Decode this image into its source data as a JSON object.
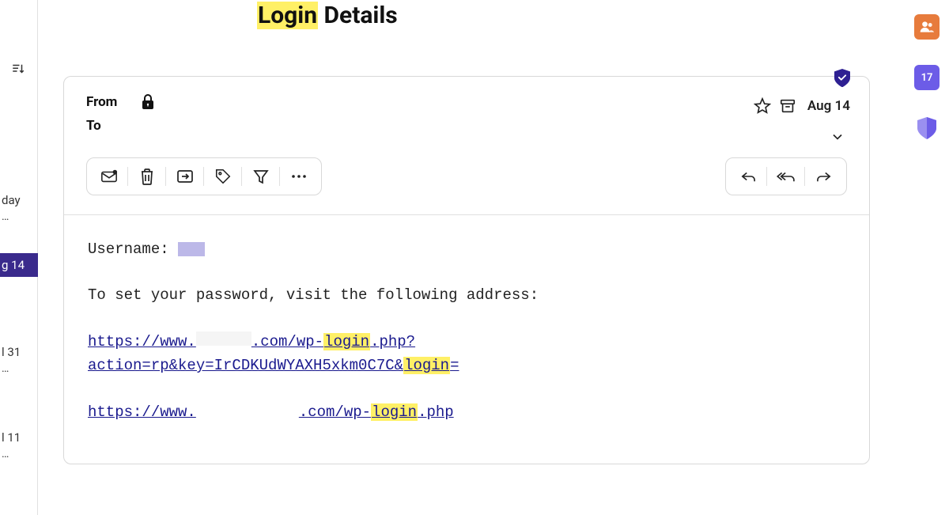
{
  "title": {
    "highlighted": "Login",
    "rest": " Details"
  },
  "sidebar_list": {
    "items": [
      {
        "primary": "day",
        "secondary": "…"
      },
      {
        "primary": "g 14",
        "secondary": ""
      },
      {
        "primary": "l 31",
        "secondary": "…"
      },
      {
        "primary": "l 11",
        "secondary": "…"
      }
    ]
  },
  "header": {
    "from_label": "From",
    "to_label": "To",
    "date": "Aug 14"
  },
  "right_rail": {
    "calendar_day": "17"
  },
  "body": {
    "username_label": "Username: ",
    "instruction": "To set your password, visit the following address:",
    "link1_a": "https://www.",
    "link1_b": ".com/wp-",
    "link1_c_hl": "login",
    "link1_d": ".php?",
    "link1_line2_a": "action=rp&key=IrCDKUdWYAXH5xkm0C7C&",
    "link1_line2_b_hl": "login",
    "link1_line2_c": "=",
    "link2_a": "https://www.",
    "link2_b": ".com/wp-",
    "link2_c_hl": "login",
    "link2_d": ".php"
  }
}
